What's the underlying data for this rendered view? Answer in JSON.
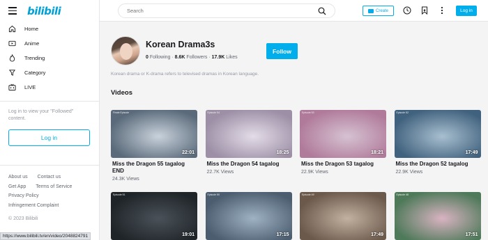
{
  "sidebar": {
    "logo": "bilibili",
    "nav": [
      {
        "label": "Home",
        "icon": "home-icon"
      },
      {
        "label": "Anime",
        "icon": "tv-icon"
      },
      {
        "label": "Trending",
        "icon": "flame-icon"
      },
      {
        "label": "Category",
        "icon": "category-icon"
      },
      {
        "label": "LIVE",
        "icon": "live-icon"
      }
    ],
    "login_prompt": "Log in to view your \"Followed\" content.",
    "login_button": "Log in",
    "footer": {
      "about": "About us",
      "contact": "Contact us",
      "get_app": "Get App",
      "terms": "Terms of Service",
      "privacy": "Privacy Policy",
      "infringement": "Infringement Complaint"
    },
    "copyright": "© 2023 Bilibili"
  },
  "status_url": "https://www.bilibili.tv/en/video/2048824791",
  "header": {
    "search_placeholder": "Search",
    "create_label": "Create",
    "login_label": "Log in"
  },
  "channel": {
    "name": "Korean Drama3s",
    "following_count": "0",
    "following_label": "Following",
    "followers_count": "8.6K",
    "followers_label": "Followers",
    "likes_count": "17.9K",
    "likes_label": "Likes",
    "follow_button": "Follow",
    "description": "Korean drama or K-drama refers to televised dramas in Korean language."
  },
  "videos_title": "Videos",
  "videos": [
    {
      "title": "Miss the Dragon 55 tagalog END",
      "views": "24.3K Views",
      "duration": "22:01",
      "tag": "Finale Episode",
      "color_a": "#5a6a7a",
      "color_b": "#c9d2dc"
    },
    {
      "title": "Miss the Dragon 54 tagalog",
      "views": "22.7K Views",
      "duration": "18:25",
      "tag": "Episode 54",
      "color_a": "#9c8fa6",
      "color_b": "#e4dce8"
    },
    {
      "title": "Miss the Dragon 53 tagalog",
      "views": "22.9K Views",
      "duration": "18:21",
      "tag": "Episode 53",
      "color_a": "#b07a9a",
      "color_b": "#d6c2d2"
    },
    {
      "title": "Miss the Dragon 52 tagalog",
      "views": "22.9K Views",
      "duration": "17:49",
      "tag": "Episode 52",
      "color_a": "#41627e",
      "color_b": "#a8bfd0"
    },
    {
      "title": "",
      "views": "",
      "duration": "19:01",
      "tag": "Episode 51",
      "color_a": "#1f2428",
      "color_b": "#4a5259"
    },
    {
      "title": "",
      "views": "",
      "duration": "17:15",
      "tag": "Episode 50",
      "color_a": "#4b5d6e",
      "color_b": "#9fb2c3"
    },
    {
      "title": "",
      "views": "",
      "duration": "17:49",
      "tag": "Episode 49",
      "color_a": "#6b5a4c",
      "color_b": "#c2b0a0"
    },
    {
      "title": "",
      "views": "",
      "duration": "17:51",
      "tag": "Episode 48",
      "color_a": "#4f7a5a",
      "color_b": "#d9b3c2"
    }
  ]
}
